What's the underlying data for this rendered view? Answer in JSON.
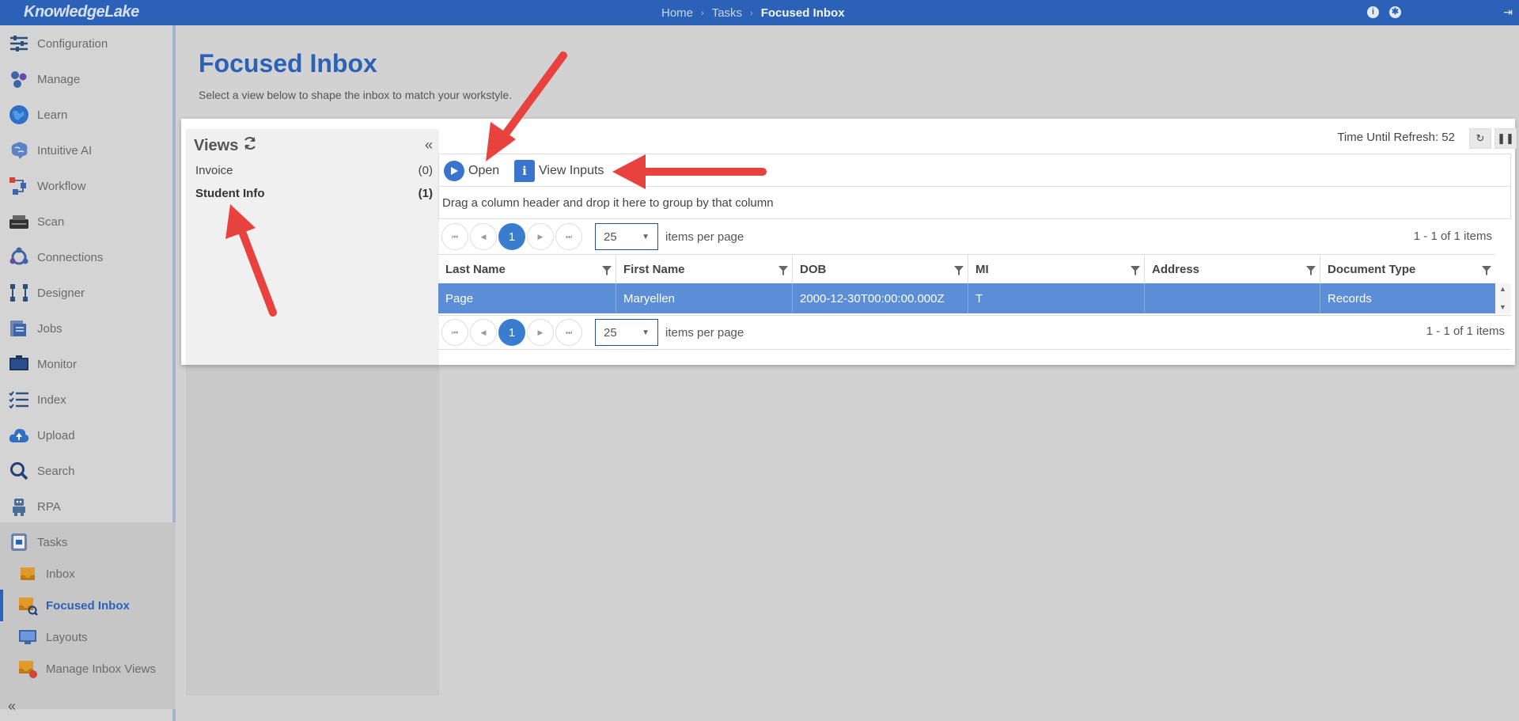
{
  "app": {
    "brand": "KnowledgeLake"
  },
  "breadcrumb": [
    "Home",
    "Tasks",
    "Focused Inbox"
  ],
  "topbar_icons": [
    "info-icon",
    "gear-icon",
    "logout-icon"
  ],
  "sidebar": {
    "items": [
      {
        "label": "Configuration",
        "icon": "sliders-icon"
      },
      {
        "label": "Manage",
        "icon": "manage-icon"
      },
      {
        "label": "Learn",
        "icon": "globe-icon"
      },
      {
        "label": "Intuitive AI",
        "icon": "brain-icon"
      },
      {
        "label": "Workflow",
        "icon": "workflow-icon"
      },
      {
        "label": "Scan",
        "icon": "scanner-icon"
      },
      {
        "label": "Connections",
        "icon": "connections-icon"
      },
      {
        "label": "Designer",
        "icon": "designer-icon"
      },
      {
        "label": "Jobs",
        "icon": "jobs-icon"
      },
      {
        "label": "Monitor",
        "icon": "monitor-icon"
      },
      {
        "label": "Index",
        "icon": "index-icon"
      },
      {
        "label": "Upload",
        "icon": "upload-icon"
      },
      {
        "label": "Search",
        "icon": "search-icon"
      },
      {
        "label": "RPA",
        "icon": "robot-icon"
      },
      {
        "label": "Tasks",
        "icon": "tasks-icon"
      }
    ],
    "subitems": [
      {
        "label": "Inbox",
        "icon": "inbox-icon"
      },
      {
        "label": "Focused Inbox",
        "icon": "focused-inbox-icon",
        "active": true
      },
      {
        "label": "Layouts",
        "icon": "layouts-icon"
      },
      {
        "label": "Manage Inbox Views",
        "icon": "manage-inbox-icon"
      }
    ],
    "collapse_label": "«"
  },
  "header": {
    "title": "Focused Inbox",
    "subtitle": "Select a view below to shape the inbox to match your workstyle."
  },
  "views": {
    "title": "Views",
    "collapse": "«",
    "items": [
      {
        "label": "Invoice",
        "count": "(0)"
      },
      {
        "label": "Student Info",
        "count": "(1)",
        "selected": true
      }
    ]
  },
  "refresh": {
    "label": "Time Until Refresh: 52"
  },
  "toolbar": {
    "open_label": "Open",
    "view_inputs_label": "View Inputs"
  },
  "groupbar": {
    "text": "Drag a column header and drop it here to group by that column"
  },
  "pager": {
    "page": "1",
    "page_size": "25",
    "items_per_page": "items per page",
    "count": "1 - 1 of 1 items"
  },
  "table": {
    "columns": [
      "Last Name",
      "First Name",
      "DOB",
      "MI",
      "Address",
      "Document Type"
    ],
    "rows": [
      [
        "Page",
        "Maryellen",
        "2000-12-30T00:00:00.000Z",
        "T",
        "",
        "Records"
      ]
    ]
  },
  "colors": {
    "accent": "#2b62b8",
    "selected_row": "#5b8ed6",
    "annotation_arrow": "#e8423e"
  }
}
